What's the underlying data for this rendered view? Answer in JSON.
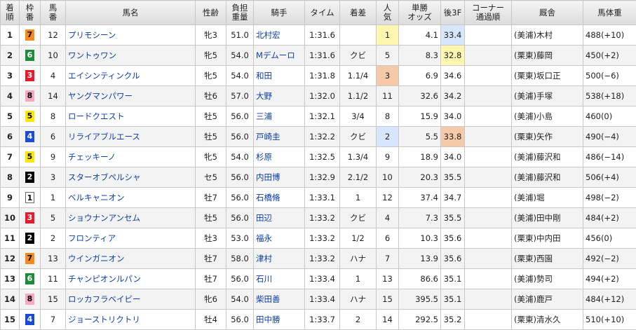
{
  "header": {
    "rank": "着\n順",
    "waku": "枠\n番",
    "umaban": "馬\n番",
    "horse": "馬名",
    "sexage": "性齢",
    "weight": "負担\n重量",
    "jockey": "騎手",
    "time": "タイム",
    "margin": "着差",
    "pop": "人\n気",
    "odds": "単勝\nオッズ",
    "last3f": "後3F",
    "corner": "コーナー\n通過順",
    "trainer": "厩舎",
    "body": "馬体重"
  },
  "waku_colors": {
    "1": "#ffffff",
    "2": "#000000",
    "3": "#e8192c",
    "4": "#1a4bd8",
    "5": "#ffe800",
    "6": "#1f8a3a",
    "7": "#f68a1e",
    "8": "#f7a8c0"
  },
  "rows": [
    {
      "rank": "1",
      "waku": "7",
      "umaban": "12",
      "horse": "プリモシーン",
      "sexage": "牝3",
      "weight": "51.0",
      "jockey": "北村宏",
      "time": "1:31.6",
      "margin": "",
      "pop": "1",
      "odds": "4.1",
      "last3f": "33.4",
      "corner": "",
      "trainer": "(美浦)木村",
      "body": "488(+10)",
      "pop_rank": 1,
      "last_rank": 2
    },
    {
      "rank": "2",
      "waku": "6",
      "umaban": "10",
      "horse": "ワントゥワン",
      "sexage": "牝5",
      "weight": "54.0",
      "jockey": "Mデムーロ",
      "time": "1:31.6",
      "margin": "クビ",
      "pop": "5",
      "odds": "8.3",
      "last3f": "32.8",
      "corner": "",
      "trainer": "(栗東)藤岡",
      "body": "450(+2)",
      "pop_rank": 0,
      "last_rank": 1
    },
    {
      "rank": "3",
      "waku": "3",
      "umaban": "4",
      "horse": "エイシンティンクル",
      "sexage": "牝5",
      "weight": "54.0",
      "jockey": "和田",
      "time": "1:31.8",
      "margin": "1.1/4",
      "pop": "3",
      "odds": "6.9",
      "last3f": "34.6",
      "corner": "",
      "trainer": "(栗東)坂口正",
      "body": "500(−6)",
      "pop_rank": 3,
      "last_rank": 0
    },
    {
      "rank": "4",
      "waku": "8",
      "umaban": "14",
      "horse": "ヤングマンパワー",
      "sexage": "牡6",
      "weight": "57.0",
      "jockey": "大野",
      "time": "1:32.0",
      "margin": "1.1/2",
      "pop": "11",
      "odds": "32.6",
      "last3f": "34.2",
      "corner": "",
      "trainer": "(美浦)手塚",
      "body": "538(+18)",
      "pop_rank": 0,
      "last_rank": 0
    },
    {
      "rank": "5",
      "waku": "5",
      "umaban": "8",
      "horse": "ロードクエスト",
      "sexage": "牡5",
      "weight": "56.0",
      "jockey": "三浦",
      "time": "1:32.1",
      "margin": "3/4",
      "pop": "8",
      "odds": "15.9",
      "last3f": "34.0",
      "corner": "",
      "trainer": "(美浦)小島",
      "body": "460(0)",
      "pop_rank": 0,
      "last_rank": 0
    },
    {
      "rank": "6",
      "waku": "4",
      "umaban": "6",
      "horse": "リライアブルエース",
      "sexage": "牡5",
      "weight": "56.0",
      "jockey": "戸崎圭",
      "time": "1:32.2",
      "margin": "クビ",
      "pop": "2",
      "odds": "5.5",
      "last3f": "33.8",
      "corner": "",
      "trainer": "(栗東)矢作",
      "body": "490(−4)",
      "pop_rank": 2,
      "last_rank": 3
    },
    {
      "rank": "7",
      "waku": "5",
      "umaban": "9",
      "horse": "チェッキーノ",
      "sexage": "牝5",
      "weight": "54.0",
      "jockey": "杉原",
      "time": "1:32.5",
      "margin": "1.3/4",
      "pop": "9",
      "odds": "18.9",
      "last3f": "34.0",
      "corner": "",
      "trainer": "(美浦)藤沢和",
      "body": "486(−14)",
      "pop_rank": 0,
      "last_rank": 0
    },
    {
      "rank": "8",
      "waku": "2",
      "umaban": "3",
      "horse": "スターオブペルシャ",
      "sexage": "セ5",
      "weight": "56.0",
      "jockey": "内田博",
      "time": "1:32.9",
      "margin": "2.1/2",
      "pop": "10",
      "odds": "20.3",
      "last3f": "35.5",
      "corner": "",
      "trainer": "(美浦)藤沢和",
      "body": "506(+4)",
      "pop_rank": 0,
      "last_rank": 0
    },
    {
      "rank": "9",
      "waku": "1",
      "umaban": "1",
      "horse": "ベルキャニオン",
      "sexage": "牡7",
      "weight": "56.0",
      "jockey": "石橋脩",
      "time": "1:33.1",
      "margin": "1",
      "pop": "12",
      "odds": "37.4",
      "last3f": "34.7",
      "corner": "",
      "trainer": "(美浦)堀",
      "body": "498(−2)",
      "pop_rank": 0,
      "last_rank": 0
    },
    {
      "rank": "10",
      "waku": "3",
      "umaban": "5",
      "horse": "ショウナンアンセム",
      "sexage": "牡5",
      "weight": "56.0",
      "jockey": "田辺",
      "time": "1:33.2",
      "margin": "クビ",
      "pop": "4",
      "odds": "7.3",
      "last3f": "35.5",
      "corner": "",
      "trainer": "(美浦)田中剛",
      "body": "484(+2)",
      "pop_rank": 0,
      "last_rank": 0
    },
    {
      "rank": "11",
      "waku": "2",
      "umaban": "2",
      "horse": "フロンティア",
      "sexage": "牡3",
      "weight": "53.0",
      "jockey": "福永",
      "time": "1:33.2",
      "margin": "1/2",
      "pop": "6",
      "odds": "10.3",
      "last3f": "35.6",
      "corner": "",
      "trainer": "(栗東)中内田",
      "body": "456(0)",
      "pop_rank": 0,
      "last_rank": 0
    },
    {
      "rank": "12",
      "waku": "7",
      "umaban": "13",
      "horse": "ウインガニオン",
      "sexage": "牡7",
      "weight": "58.0",
      "jockey": "津村",
      "time": "1:33.2",
      "margin": "ハナ",
      "pop": "7",
      "odds": "13.9",
      "last3f": "35.6",
      "corner": "",
      "trainer": "(栗東)西園",
      "body": "492(−2)",
      "pop_rank": 0,
      "last_rank": 0
    },
    {
      "rank": "13",
      "waku": "6",
      "umaban": "11",
      "horse": "チャンピオンルパン",
      "sexage": "牡7",
      "weight": "56.0",
      "jockey": "石川",
      "time": "1:33.4",
      "margin": "1",
      "pop": "13",
      "odds": "86.6",
      "last3f": "35.1",
      "corner": "",
      "trainer": "(美浦)勢司",
      "body": "494(+2)",
      "pop_rank": 0,
      "last_rank": 0
    },
    {
      "rank": "14",
      "waku": "8",
      "umaban": "15",
      "horse": "ロッカフラベイビー",
      "sexage": "牝6",
      "weight": "54.0",
      "jockey": "柴田善",
      "time": "1:33.4",
      "margin": "ハナ",
      "pop": "15",
      "odds": "395.5",
      "last3f": "35.1",
      "corner": "",
      "trainer": "(美浦)鹿戸",
      "body": "484(+12)",
      "pop_rank": 0,
      "last_rank": 0
    },
    {
      "rank": "15",
      "waku": "4",
      "umaban": "7",
      "horse": "ジョーストリクトリ",
      "sexage": "牡4",
      "weight": "56.0",
      "jockey": "田中勝",
      "time": "1:33.7",
      "margin": "2",
      "pop": "14",
      "odds": "292.5",
      "last3f": "35.2",
      "corner": "",
      "trainer": "(栗東)清水久",
      "body": "510(+10)",
      "pop_rank": 0,
      "last_rank": 0
    }
  ]
}
